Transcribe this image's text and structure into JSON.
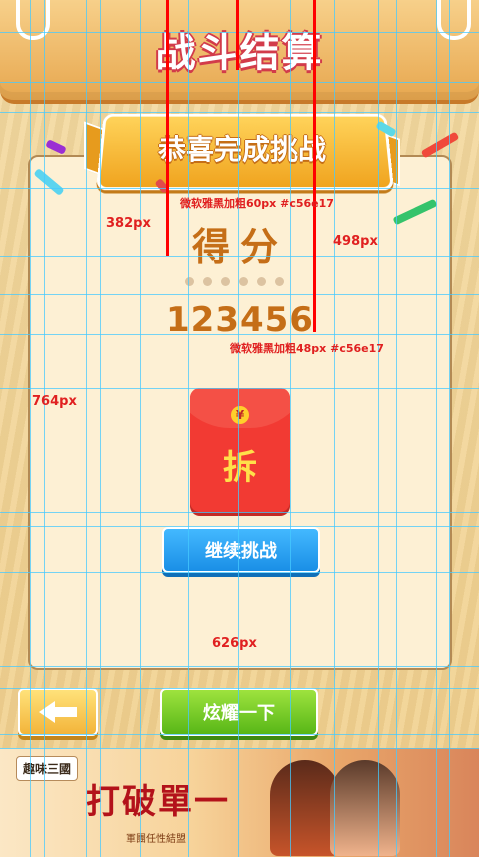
{
  "header": {
    "title": "战斗结算"
  },
  "banner": {
    "text": "恭喜完成挑战"
  },
  "score": {
    "label": "得分",
    "value": "123456"
  },
  "red_envelope": {
    "label": "拆"
  },
  "buttons": {
    "continue": "继续挑战",
    "share": "炫耀一下"
  },
  "annotations": {
    "font_spec_60": "微软雅黑加粗60px #c56e17",
    "font_spec_48": "微软雅黑加粗48px #c56e17",
    "m382": "382px",
    "m498": "498px",
    "m764": "764px",
    "m626": "626px"
  },
  "ad": {
    "headline": "打破單一",
    "subtitle": "軍團任性結盟",
    "logo": "趣味三國"
  },
  "colors": {
    "score_text": "#c56e17",
    "title_outline": "#d23b4a",
    "annotation": "#e02020",
    "guide": "#46c9ff"
  }
}
